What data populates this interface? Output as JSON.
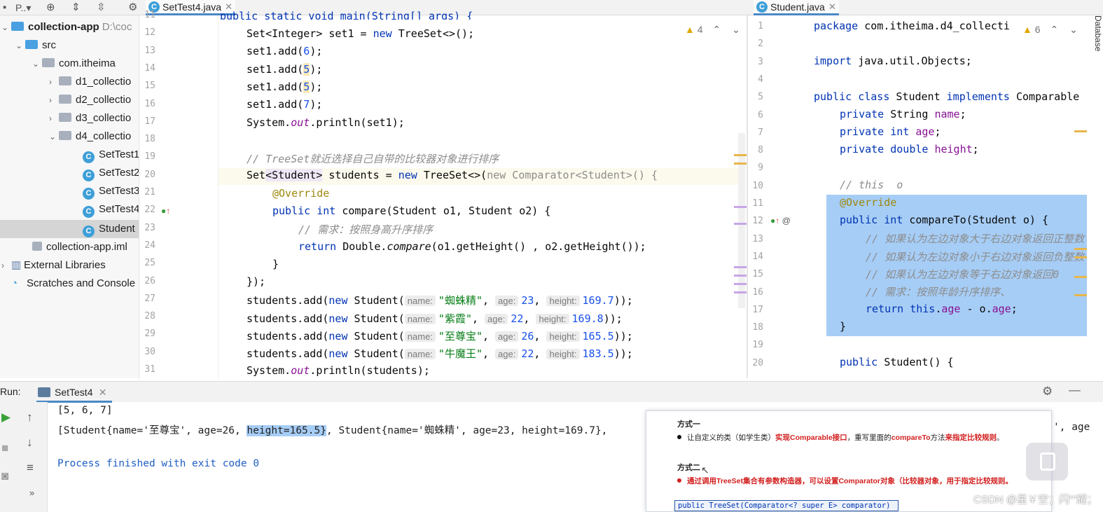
{
  "toolbar": {
    "project_label": "P..▾",
    "gear": "⚙"
  },
  "tabs": [
    {
      "label": "SetTest4.java",
      "active": true
    },
    {
      "label": "Student.java",
      "active": false
    }
  ],
  "tree": {
    "items": [
      {
        "label": "collection-app",
        "hint": "D:\\coc",
        "kind": "module"
      },
      {
        "label": "src",
        "kind": "src"
      },
      {
        "label": "com.itheima",
        "kind": "pkg"
      },
      {
        "label": "d1_collectio",
        "kind": "pkg"
      },
      {
        "label": "d2_collectio",
        "kind": "pkg"
      },
      {
        "label": "d3_collectio",
        "kind": "pkg"
      },
      {
        "label": "d4_collectio",
        "kind": "pkg"
      },
      {
        "label": "SetTest1",
        "kind": "class"
      },
      {
        "label": "SetTest2",
        "kind": "class"
      },
      {
        "label": "SetTest3",
        "kind": "class"
      },
      {
        "label": "SetTest4",
        "kind": "class"
      },
      {
        "label": "Student",
        "kind": "class"
      },
      {
        "label": "collection-app.iml",
        "kind": "file"
      },
      {
        "label": "External Libraries",
        "kind": "lib"
      },
      {
        "label": "Scratches and Console",
        "kind": "scratch"
      }
    ]
  },
  "left_editor": {
    "warnings": "4",
    "line_numbers": [
      "11",
      "12",
      "13",
      "14",
      "15",
      "16",
      "17",
      "18",
      "19",
      "20",
      "21",
      "22",
      "23",
      "24",
      "25",
      "26",
      "27",
      "28",
      "29",
      "30",
      "31"
    ],
    "lines": {
      "l11": "public static void main(String[] args) {",
      "l12a": "Set<Integer> set1 = ",
      "l12b": "new",
      "l12c": " TreeSet<>();",
      "l13": "set1.add(",
      "l13n": "6",
      "l13e": ");",
      "l14": "set1.add(",
      "l14n": "5",
      "l14e": ");",
      "l15": "set1.add(",
      "l15n": "5",
      "l15e": ");",
      "l16": "set1.add(",
      "l16n": "7",
      "l16e": ");",
      "l17a": "System.",
      "l17b": "out",
      "l17c": ".println(set1);",
      "l19": "// TreeSet就近选择自己自带的比较器对象进行排序",
      "l20a": "Set",
      "l20b": "<Student>",
      "l20c": " students = ",
      "l20d": "new",
      "l20e": " TreeSet<>(",
      "l20f": "new Comparator<Student>() {",
      "l21": "@Override",
      "l22a": "public int ",
      "l22b": "compare(Student o1, Student o2) {",
      "l23": "// 需求：按照身高升序排序",
      "l24a": "return",
      "l24b": " Double.",
      "l24c": "compare",
      "l24d": "(o1.getHeight() , o2.getHeight());",
      "l25": "}",
      "l26": "});",
      "students": [
        {
          "name": "\"蜘蛛精\"",
          "age": "23",
          "height": "169.7"
        },
        {
          "name": "\"紫霞\"",
          "age": "22",
          "height": "169.8"
        },
        {
          "name": "\"至尊宝\"",
          "age": "26",
          "height": "165.5"
        },
        {
          "name": "\"牛魔王\"",
          "age": "22",
          "height": "183.5"
        }
      ],
      "add_prefix": "students.add(",
      "new_kw": "new",
      "student_cls": " Student(",
      "hint_name": "name:",
      "hint_age": "age:",
      "hint_height": "height:",
      "add_suffix": "));",
      "l31a": "System.",
      "l31b": "out",
      "l31c": ".println(students);"
    }
  },
  "right_editor": {
    "warnings": "6",
    "line_numbers": [
      "1",
      "2",
      "3",
      "4",
      "5",
      "6",
      "7",
      "8",
      "9",
      "10",
      "11",
      "12",
      "13",
      "14",
      "15",
      "16",
      "17",
      "18",
      "19",
      "20"
    ],
    "lines": {
      "r1a": "package",
      "r1b": " com.itheima.d4_collecti",
      "r3a": "import",
      "r3b": " java.util.Objects;",
      "r5a": "public class",
      "r5b": " Student ",
      "r5c": "implements",
      "r5d": " Comparable",
      "r6a": "private",
      "r6b": " String ",
      "r6c": "name",
      "r6d": ";",
      "r7a": "private int",
      "r7b": " age",
      "r7c": ";",
      "r8a": "private double",
      "r8b": " height",
      "r8c": ";",
      "r10": "// this  o",
      "r11": "@Override",
      "r12a": "public int",
      "r12b": " compareTo(Student o) {",
      "r13": "// 如果认为左边对象大于右边对象返回正整数",
      "r14": "// 如果认为左边对象小于右边对象返回负整数",
      "r15": "// 如果认为左边对象等于右边对象返回0",
      "r16": "// 需求：按照年龄升序排序、",
      "r17a": "return this",
      "r17b": ".",
      "r17c": "age",
      "r17d": " - o.",
      "r17e": "age",
      "r17f": ";",
      "r18": "}",
      "r20a": "public",
      "r20b": " Student() {"
    }
  },
  "run": {
    "label": "Run:",
    "tab": "SetTest4",
    "out1": "[5, 6, 7]",
    "out2a": "[Student{name='至尊宝', age=26, ",
    "out2b": "height=165.5}",
    "out2c": ", Student{name='蜘蛛精', age=23, height=169.7},",
    "out2tail": "', age",
    "out3": "Process finished with exit code 0"
  },
  "popup": {
    "head1": "方式一",
    "line1a": "让自定义的类（如学生类）",
    "line1b": "实现Comparable接口",
    "line1c": "，重写里面的",
    "line1d": "compareTo",
    "line1e": "方法",
    "line1f": "来指定比较规则",
    "line1g": "。",
    "head2": "方式二",
    "line2": "通过调用TreeSet集合有参数构造器，可以设置Comparator对象（比较器对象，用于指定比较规则。",
    "code": "public TreeSet(Comparator<? super E> comparator)"
  },
  "side_panel": "Database",
  "watermark": "CSDN @星￥空；闪“”耀；"
}
